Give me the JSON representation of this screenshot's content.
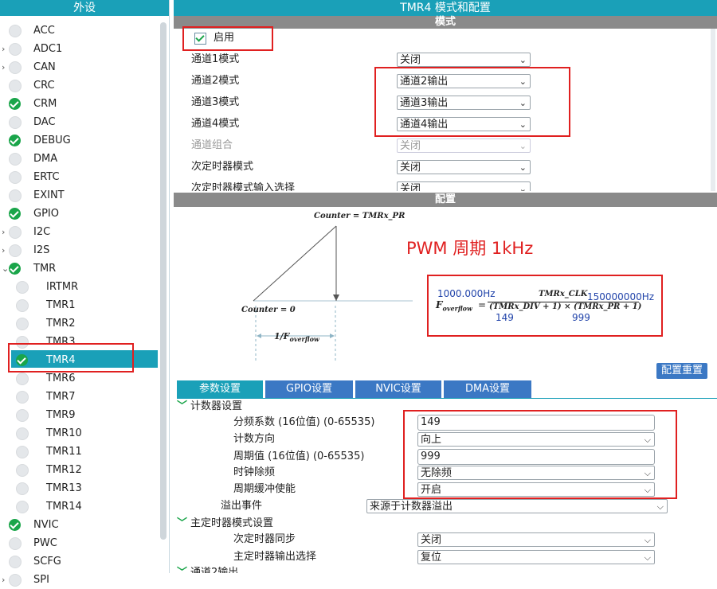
{
  "sidebar": {
    "title": "外设",
    "items": [
      {
        "label": "ACC",
        "checked": false,
        "arrow": false,
        "indent": 0
      },
      {
        "label": "ADC1",
        "checked": false,
        "arrow": true,
        "indent": 0
      },
      {
        "label": "CAN",
        "checked": false,
        "arrow": true,
        "indent": 0
      },
      {
        "label": "CRC",
        "checked": false,
        "arrow": false,
        "indent": 0
      },
      {
        "label": "CRM",
        "checked": true,
        "arrow": false,
        "indent": 0
      },
      {
        "label": "DAC",
        "checked": false,
        "arrow": false,
        "indent": 0
      },
      {
        "label": "DEBUG",
        "checked": true,
        "arrow": false,
        "indent": 0
      },
      {
        "label": "DMA",
        "checked": false,
        "arrow": false,
        "indent": 0
      },
      {
        "label": "ERTC",
        "checked": false,
        "arrow": false,
        "indent": 0
      },
      {
        "label": "EXINT",
        "checked": false,
        "arrow": false,
        "indent": 0
      },
      {
        "label": "GPIO",
        "checked": true,
        "arrow": false,
        "indent": 0
      },
      {
        "label": "I2C",
        "checked": false,
        "arrow": true,
        "indent": 0
      },
      {
        "label": "I2S",
        "checked": false,
        "arrow": true,
        "indent": 0
      },
      {
        "label": "TMR",
        "checked": true,
        "arrow": true,
        "indent": 0,
        "expanded": true
      },
      {
        "label": "IRTMR",
        "checked": false,
        "arrow": false,
        "indent": 1
      },
      {
        "label": "TMR1",
        "checked": false,
        "arrow": false,
        "indent": 1
      },
      {
        "label": "TMR2",
        "checked": false,
        "arrow": false,
        "indent": 1
      },
      {
        "label": "TMR3",
        "checked": false,
        "arrow": false,
        "indent": 1
      },
      {
        "label": "TMR4",
        "checked": true,
        "arrow": false,
        "indent": 1,
        "selected": true
      },
      {
        "label": "TMR6",
        "checked": false,
        "arrow": false,
        "indent": 1
      },
      {
        "label": "TMR7",
        "checked": false,
        "arrow": false,
        "indent": 1
      },
      {
        "label": "TMR9",
        "checked": false,
        "arrow": false,
        "indent": 1
      },
      {
        "label": "TMR10",
        "checked": false,
        "arrow": false,
        "indent": 1
      },
      {
        "label": "TMR11",
        "checked": false,
        "arrow": false,
        "indent": 1
      },
      {
        "label": "TMR12",
        "checked": false,
        "arrow": false,
        "indent": 1
      },
      {
        "label": "TMR13",
        "checked": false,
        "arrow": false,
        "indent": 1
      },
      {
        "label": "TMR14",
        "checked": false,
        "arrow": false,
        "indent": 1
      },
      {
        "label": "NVIC",
        "checked": true,
        "arrow": false,
        "indent": 0
      },
      {
        "label": "PWC",
        "checked": false,
        "arrow": false,
        "indent": 0
      },
      {
        "label": "SCFG",
        "checked": false,
        "arrow": false,
        "indent": 0
      },
      {
        "label": "SPI",
        "checked": false,
        "arrow": true,
        "indent": 0
      }
    ]
  },
  "panel": {
    "title": "TMR4 模式和配置",
    "mode_header": "模式",
    "enable_label": "启用",
    "mode_rows": [
      {
        "label": "通道1模式",
        "value": "关闭",
        "disabled": false
      },
      {
        "label": "通道2模式",
        "value": "通道2输出",
        "disabled": false
      },
      {
        "label": "通道3模式",
        "value": "通道3输出",
        "disabled": false
      },
      {
        "label": "通道4模式",
        "value": "通道4输出",
        "disabled": false
      },
      {
        "label": "通道组合",
        "value": "关闭",
        "disabled": true
      },
      {
        "label": "次定时器模式",
        "value": "关闭",
        "disabled": false
      },
      {
        "label": "次定时器模式输入选择",
        "value": "关闭",
        "disabled": false
      }
    ],
    "config_header": "配置",
    "reset_button": "配置重置"
  },
  "diagram": {
    "counter_pr": "Counter = TMRx_PR",
    "counter_zero": "Counter = 0",
    "period_label": "1/F",
    "period_sub": "overflow",
    "pwm_annotation": "PWM 周期 1kHz",
    "formula": {
      "freq_result": "1000.000Hz",
      "f_symbol": "F",
      "f_sub": "overflow",
      "equals": "=",
      "numerator": "TMRx_CLK",
      "clk_value": "150000000Hz",
      "denominator": "(TMRx_DIV + 1) × (TMRx_PR + 1)",
      "div_value": "149",
      "pr_value": "999"
    }
  },
  "tabs": [
    "参数设置",
    "GPIO设置",
    "NVIC设置",
    "DMA设置"
  ],
  "params": {
    "counter_group": "计数器设置",
    "divider_label": "分频系数 (16位值) (0-65535)",
    "divider_value": "149",
    "direction_label": "计数方向",
    "direction_value": "向上",
    "period_label": "周期值 (16位值) (0-65535)",
    "period_value": "999",
    "clock_div_label": "时钟除频",
    "clock_div_value": "无除频",
    "buffer_label": "周期缓冲使能",
    "buffer_value": "开启",
    "overflow_label": "溢出事件",
    "overflow_value": "来源于计数器溢出",
    "master_group": "主定时器模式设置",
    "sub_sync_label": "次定时器同步",
    "sub_sync_value": "关闭",
    "master_out_label": "主定时器输出选择",
    "master_out_value": "复位",
    "channel_group": "通道2输出"
  },
  "colors": {
    "accent": "#1aa0b8",
    "tab_blue": "#3b78c4",
    "check_green": "#1aa54a",
    "annotation_red": "#e02020"
  }
}
